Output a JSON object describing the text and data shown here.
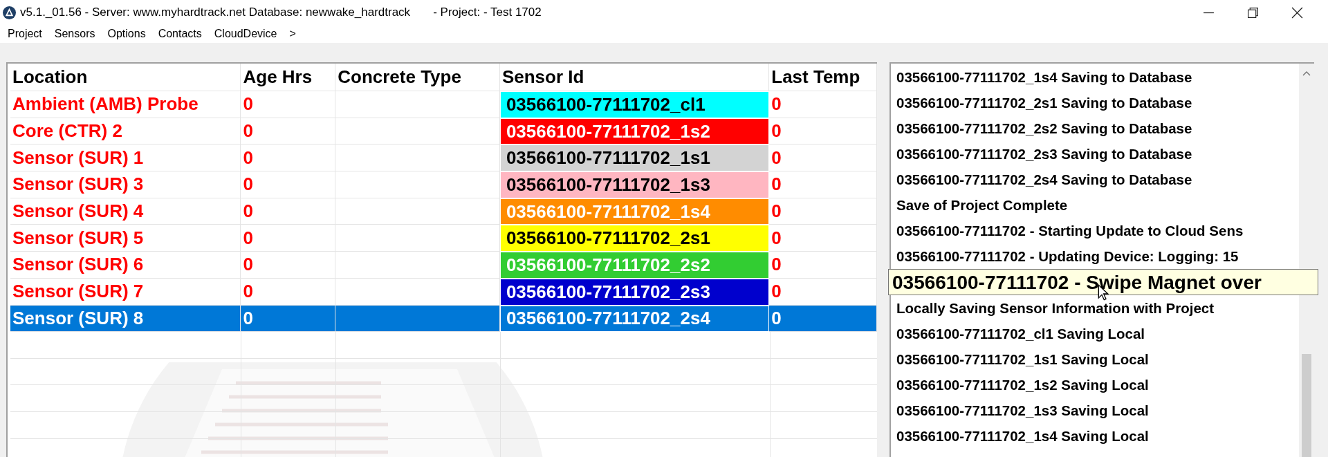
{
  "window": {
    "title": "v5.1._01.56 - Server: www.myhardtrack.net Database: newwake_hardtrack       - Project: - Test 1702"
  },
  "menu": [
    "Project",
    "Sensors",
    "Options",
    "Contacts",
    "CloudDevice",
    ">"
  ],
  "table": {
    "columns": [
      "Location",
      "Age Hrs",
      "Concrete Type",
      "Sensor Id",
      "Last Temp"
    ],
    "rows": [
      {
        "location": "Ambient (AMB) Probe",
        "age": "0",
        "sensor_id": "03566100-77111702_cl1",
        "color": "#00ffff",
        "last_temp": "0",
        "selected": false
      },
      {
        "location": "Core (CTR) 2",
        "age": "0",
        "sensor_id": "03566100-77111702_1s2",
        "color": "#ff0000",
        "last_temp": "0",
        "selected": false
      },
      {
        "location": "Sensor (SUR) 1",
        "age": "0",
        "sensor_id": "03566100-77111702_1s1",
        "color": "#d3d3d3",
        "last_temp": "0",
        "selected": false
      },
      {
        "location": "Sensor (SUR) 3",
        "age": "0",
        "sensor_id": "03566100-77111702_1s3",
        "color": "#ffb6c1",
        "last_temp": "0",
        "selected": false
      },
      {
        "location": "Sensor (SUR) 4",
        "age": "0",
        "sensor_id": "03566100-77111702_1s4",
        "color": "#ff8c00",
        "last_temp": "0",
        "selected": false
      },
      {
        "location": "Sensor (SUR) 5",
        "age": "0",
        "sensor_id": "03566100-77111702_2s1",
        "color": "#ffff00",
        "last_temp": "0",
        "selected": false
      },
      {
        "location": "Sensor (SUR) 6",
        "age": "0",
        "sensor_id": "03566100-77111702_2s2",
        "color": "#32cd32",
        "last_temp": "0",
        "selected": false
      },
      {
        "location": "Sensor (SUR) 7",
        "age": "0",
        "sensor_id": "03566100-77111702_2s3",
        "color": "#0000cd",
        "last_temp": "0",
        "selected": false
      },
      {
        "location": "Sensor (SUR) 8",
        "age": "0",
        "sensor_id": "03566100-77111702_2s4",
        "color": "#0078d7",
        "last_temp": "0",
        "selected": true
      }
    ]
  },
  "log": {
    "items_above": [
      "03566100-77111702_1s4 Saving to Database",
      "03566100-77111702_2s1 Saving to Database",
      "03566100-77111702_2s2 Saving to Database",
      "03566100-77111702_2s3 Saving to Database",
      "03566100-77111702_2s4 Saving to Database",
      "Save of Project Complete",
      "03566100-77111702 - Starting Update to Cloud Sens",
      "03566100-77111702 - Updating Device: Logging: 15"
    ],
    "tooltip": "03566100-77111702 - Swipe Magnet over",
    "items_below": [
      "Locally Saving Sensor Information with Project",
      "03566100-77111702_cl1 Saving Local",
      "03566100-77111702_1s1 Saving Local",
      "03566100-77111702_1s2 Saving Local",
      "03566100-77111702_1s3 Saving Local",
      "03566100-77111702_1s4 Saving Local"
    ]
  }
}
